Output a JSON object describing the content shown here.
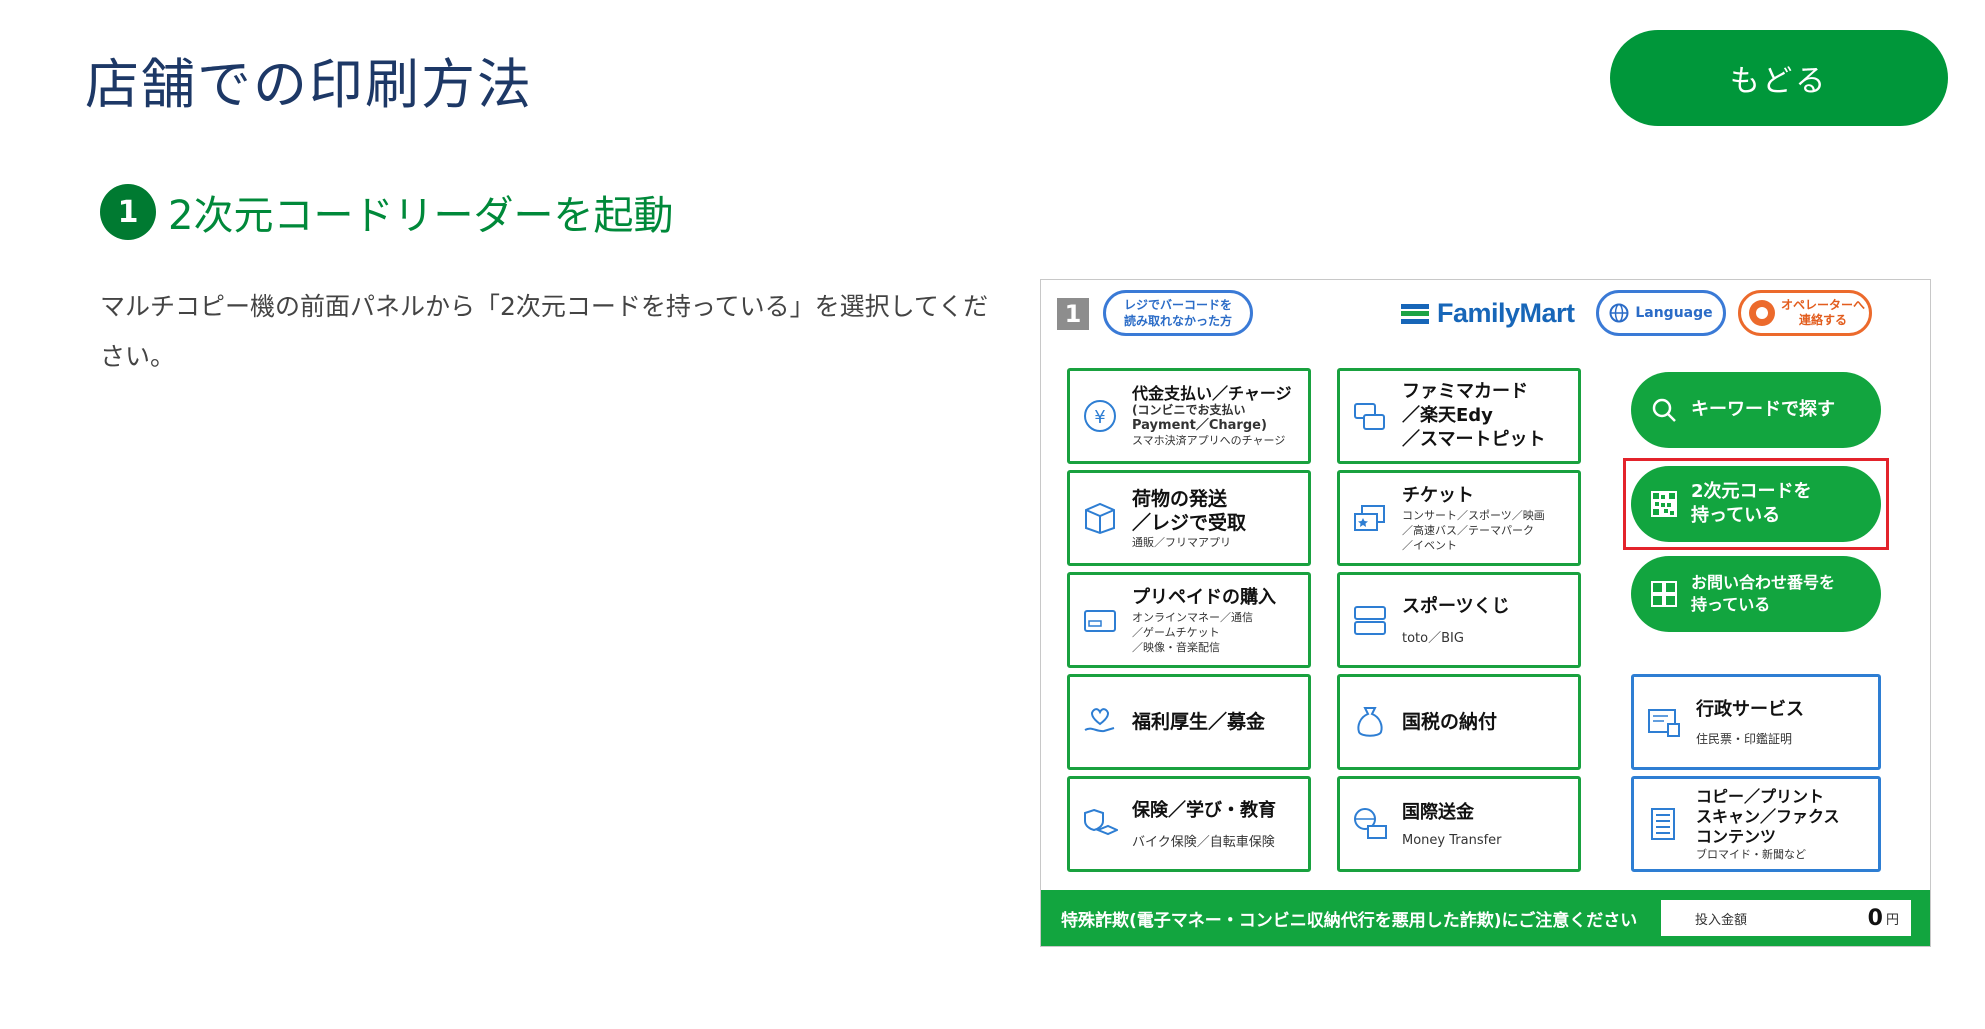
{
  "header": {
    "title": "店舗での印刷方法",
    "back_label": "もどる"
  },
  "step": {
    "number": "1",
    "title": "2次元コードリーダーを起動",
    "description": "マルチコピー機の前面パネルから「2次元コードを持っている」を選択してください。"
  },
  "panel": {
    "screen_number": "1",
    "barcode_help_line1": "レジでバーコードを",
    "barcode_help_line2": "読み取れなかった方",
    "brand": "FamilyMart",
    "language_label": "Language",
    "operator_line1": "オペレーターへ",
    "operator_line2": "連絡する",
    "tiles": {
      "payment": {
        "main": "代金支払い／チャージ",
        "sub1": "(コンビニでお支払い",
        "sub2": "Payment／Charge)",
        "sub3": "スマホ決済アプリへのチャージ"
      },
      "famimacard": {
        "line1": "ファミマカード",
        "line2": "／楽天Edy",
        "line3": "／スマートピット"
      },
      "parcel": {
        "line1": "荷物の発送",
        "line2": "／レジで受取",
        "sub": "通販／フリマアプリ"
      },
      "ticket": {
        "main": "チケット",
        "sub1": "コンサート／スポーツ／映画",
        "sub2": "／高速バス／テーマパーク",
        "sub3": "／イベント"
      },
      "prepaid": {
        "main": "プリペイドの購入",
        "sub1": "オンラインマネー／通信",
        "sub2": "／ゲームチケット",
        "sub3": "／映像・音楽配信"
      },
      "sports": {
        "main": "スポーツくじ",
        "sub": "toto／BIG"
      },
      "welfare": {
        "main": "福利厚生／募金"
      },
      "tax": {
        "main": "国税の納付"
      },
      "insurance": {
        "main": "保険／学び・教育",
        "sub": "バイク保険／自転車保険"
      },
      "remit": {
        "main": "国際送金",
        "sub": "Money Transfer"
      },
      "admin": {
        "main": "行政サービス",
        "sub": "住民票・印鑑証明"
      },
      "copy": {
        "line1": "コピー／プリント",
        "line2": "スキャン／ファクス",
        "line3": "コンテンツ",
        "sub": "ブロマイド・新聞など"
      }
    },
    "pills": {
      "keyword": "キーワードで探す",
      "qr_line1": "2次元コードを",
      "qr_line2": "持っている",
      "inquiry_line1": "お問い合わせ番号を",
      "inquiry_line2": "持っている"
    },
    "notice": "特殊詐欺(電子マネー・コンビニ収納代行を悪用した詐欺)にご注意ください",
    "deposit_label": "投入金額",
    "deposit_value": "0",
    "deposit_unit": "円"
  },
  "colors": {
    "brand_green": "#00973a",
    "title_navy": "#1d3866",
    "tile_green": "#19a13f",
    "tile_blue": "#2e7ed3",
    "highlight_red": "#e3232b"
  }
}
